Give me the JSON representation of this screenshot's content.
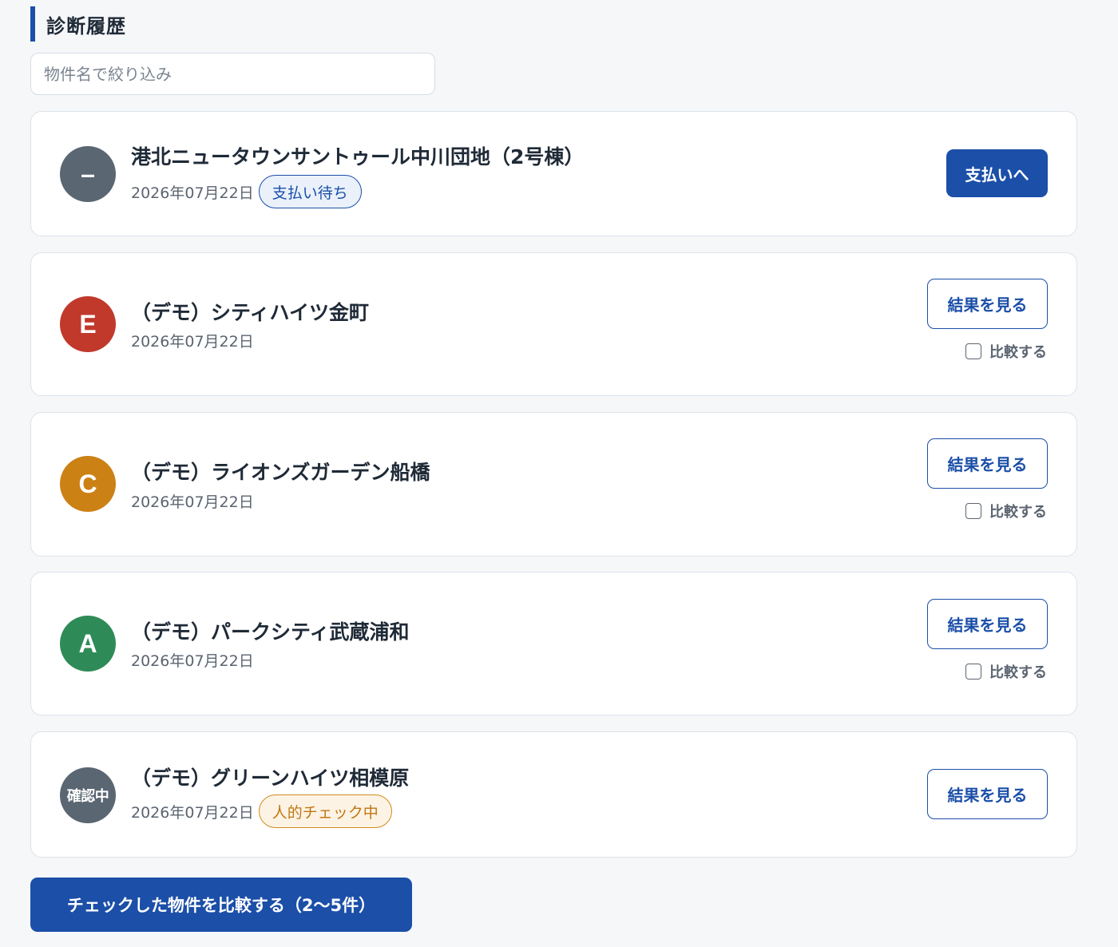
{
  "section": {
    "title": "診断履歴"
  },
  "filter": {
    "placeholder": "物件名で絞り込み",
    "value": ""
  },
  "items": [
    {
      "avatar": "–",
      "avatar_color": "#5a6672",
      "name": "港北ニュータウンサントゥール中川団地（2号棟）",
      "date": "2026年07月22日",
      "badge": "支払い待ち",
      "badge_style": "blue",
      "action": "支払いへ",
      "compare_label": ""
    },
    {
      "avatar": "E",
      "avatar_color": "#c0392b",
      "name": "（デモ）シティハイツ金町",
      "date": "2026年07月22日",
      "badge": "",
      "action": "結果を見る",
      "compare_label": "比較する",
      "compare_checked": false
    },
    {
      "avatar": "C",
      "avatar_color": "#cc8115",
      "name": "（デモ）ライオンズガーデン船橋",
      "date": "2026年07月22日",
      "badge": "",
      "action": "結果を見る",
      "compare_label": "比較する",
      "compare_checked": false
    },
    {
      "avatar": "A",
      "avatar_color": "#2e8b57",
      "name": "（デモ）パークシティ武蔵浦和",
      "date": "2026年07月22日",
      "badge": "",
      "action": "結果を見る",
      "compare_label": "比較する",
      "compare_checked": false
    },
    {
      "avatar": "確認中",
      "avatar_color": "#5a6672",
      "name": "（デモ）グリーンハイツ相模原",
      "date": "2026年07月22日",
      "badge": "人的チェック中",
      "badge_style": "orange",
      "action": "結果を見る",
      "compare_label": ""
    }
  ],
  "compare_button": {
    "label": "チェックした物件を比較する（2〜5件）"
  },
  "colors": {
    "primary": "#1b4fa8",
    "status_pending": "#1b4fa8",
    "status_review": "#d08a1e"
  }
}
